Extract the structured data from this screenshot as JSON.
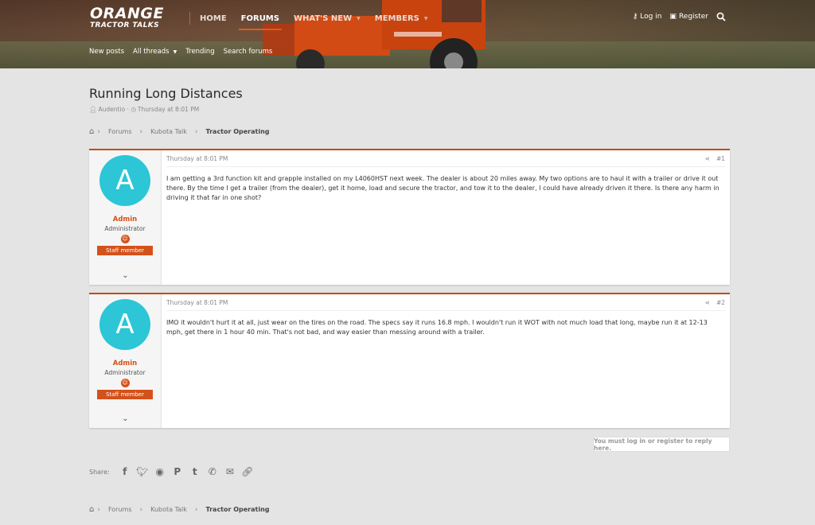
{
  "header": {
    "logo_line1": "ORANGE",
    "logo_line2": "TRACTOR TALKS",
    "nav": [
      {
        "label": "HOME"
      },
      {
        "label": "FORUMS"
      },
      {
        "label": "WHAT'S NEW"
      },
      {
        "label": "MEMBERS"
      }
    ],
    "login_label": "Log in",
    "register_label": "Register",
    "subnav": [
      {
        "label": "New posts"
      },
      {
        "label": "All threads"
      },
      {
        "label": "Trending"
      },
      {
        "label": "Search forums"
      }
    ]
  },
  "thread": {
    "title": "Running Long Distances",
    "author": "Audentio",
    "date": "Thursday at 8:01 PM"
  },
  "breadcrumb": [
    "Forums",
    "Kubota Talk",
    "Tractor Operating"
  ],
  "posts": [
    {
      "avatar_letter": "A",
      "username": "Admin",
      "user_title": "Administrator",
      "staff_label": "Staff member",
      "date": "Thursday at 8:01 PM",
      "number": "#1",
      "body": "I am getting a 3rd function kit and grapple installed on my L4060HST next week. The dealer is about 20 miles away. My two options are to haul it with a trailer or drive it out there. By the time I get a trailer (from the dealer), get it home, load and secure the tractor, and tow it to the dealer, I could have already driven it there. Is there any harm in driving it that far in one shot?"
    },
    {
      "avatar_letter": "A",
      "username": "Admin",
      "user_title": "Administrator",
      "staff_label": "Staff member",
      "date": "Thursday at 8:01 PM",
      "number": "#2",
      "body": "IMO it wouldn't hurt it at all, just wear on the tires on the road. The specs say it runs 16.8 mph. I wouldn't run it WOT with not much load that long, maybe run it at 12-13 mph, get there in 1 hour 40 min. That's not bad, and way easier than messing around with a trailer."
    }
  ],
  "reply_note": "You must log in or register to reply here.",
  "share": {
    "label": "Share:",
    "icons": [
      "facebook-icon",
      "twitter-icon",
      "reddit-icon",
      "pinterest-icon",
      "tumblr-icon",
      "whatsapp-icon",
      "email-icon",
      "link-icon"
    ]
  },
  "colors": {
    "accent": "#d4511a",
    "avatar": "#2cc6d6",
    "background": "#e4e4e4"
  }
}
